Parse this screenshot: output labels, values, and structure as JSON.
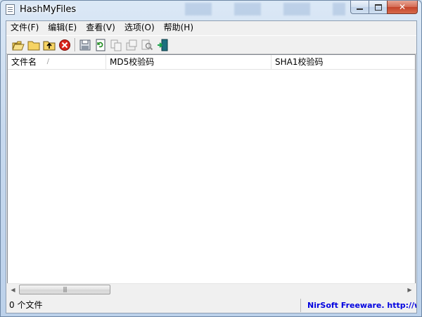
{
  "window": {
    "title": "HashMyFiles"
  },
  "menu": [
    {
      "label": "文件(F)"
    },
    {
      "label": "编辑(E)"
    },
    {
      "label": "查看(V)"
    },
    {
      "label": "选项(O)"
    },
    {
      "label": "帮助(H)"
    }
  ],
  "toolbar": {
    "buttons": [
      {
        "icon": "open-files-icon"
      },
      {
        "icon": "open-folder-icon"
      },
      {
        "icon": "add-folder-icon"
      },
      {
        "icon": "delete-icon"
      },
      {
        "icon": "save-icon"
      },
      {
        "icon": "refresh-icon"
      },
      {
        "icon": "copy-icon"
      },
      {
        "icon": "properties-icon"
      },
      {
        "icon": "find-icon"
      },
      {
        "icon": "exit-icon"
      }
    ]
  },
  "list": {
    "columns": [
      {
        "label": "文件名"
      },
      {
        "label": "MD5校验码"
      },
      {
        "label": "SHA1校验码"
      }
    ],
    "sort_glyph": "/",
    "rows": []
  },
  "scrollbar": {
    "grip": "|||"
  },
  "status": {
    "count_text": "0 个文件",
    "credit_text": "NirSoft Freeware.  http://www."
  },
  "colors": {
    "credit": "#0000e0",
    "close_button": "#c4432a"
  }
}
